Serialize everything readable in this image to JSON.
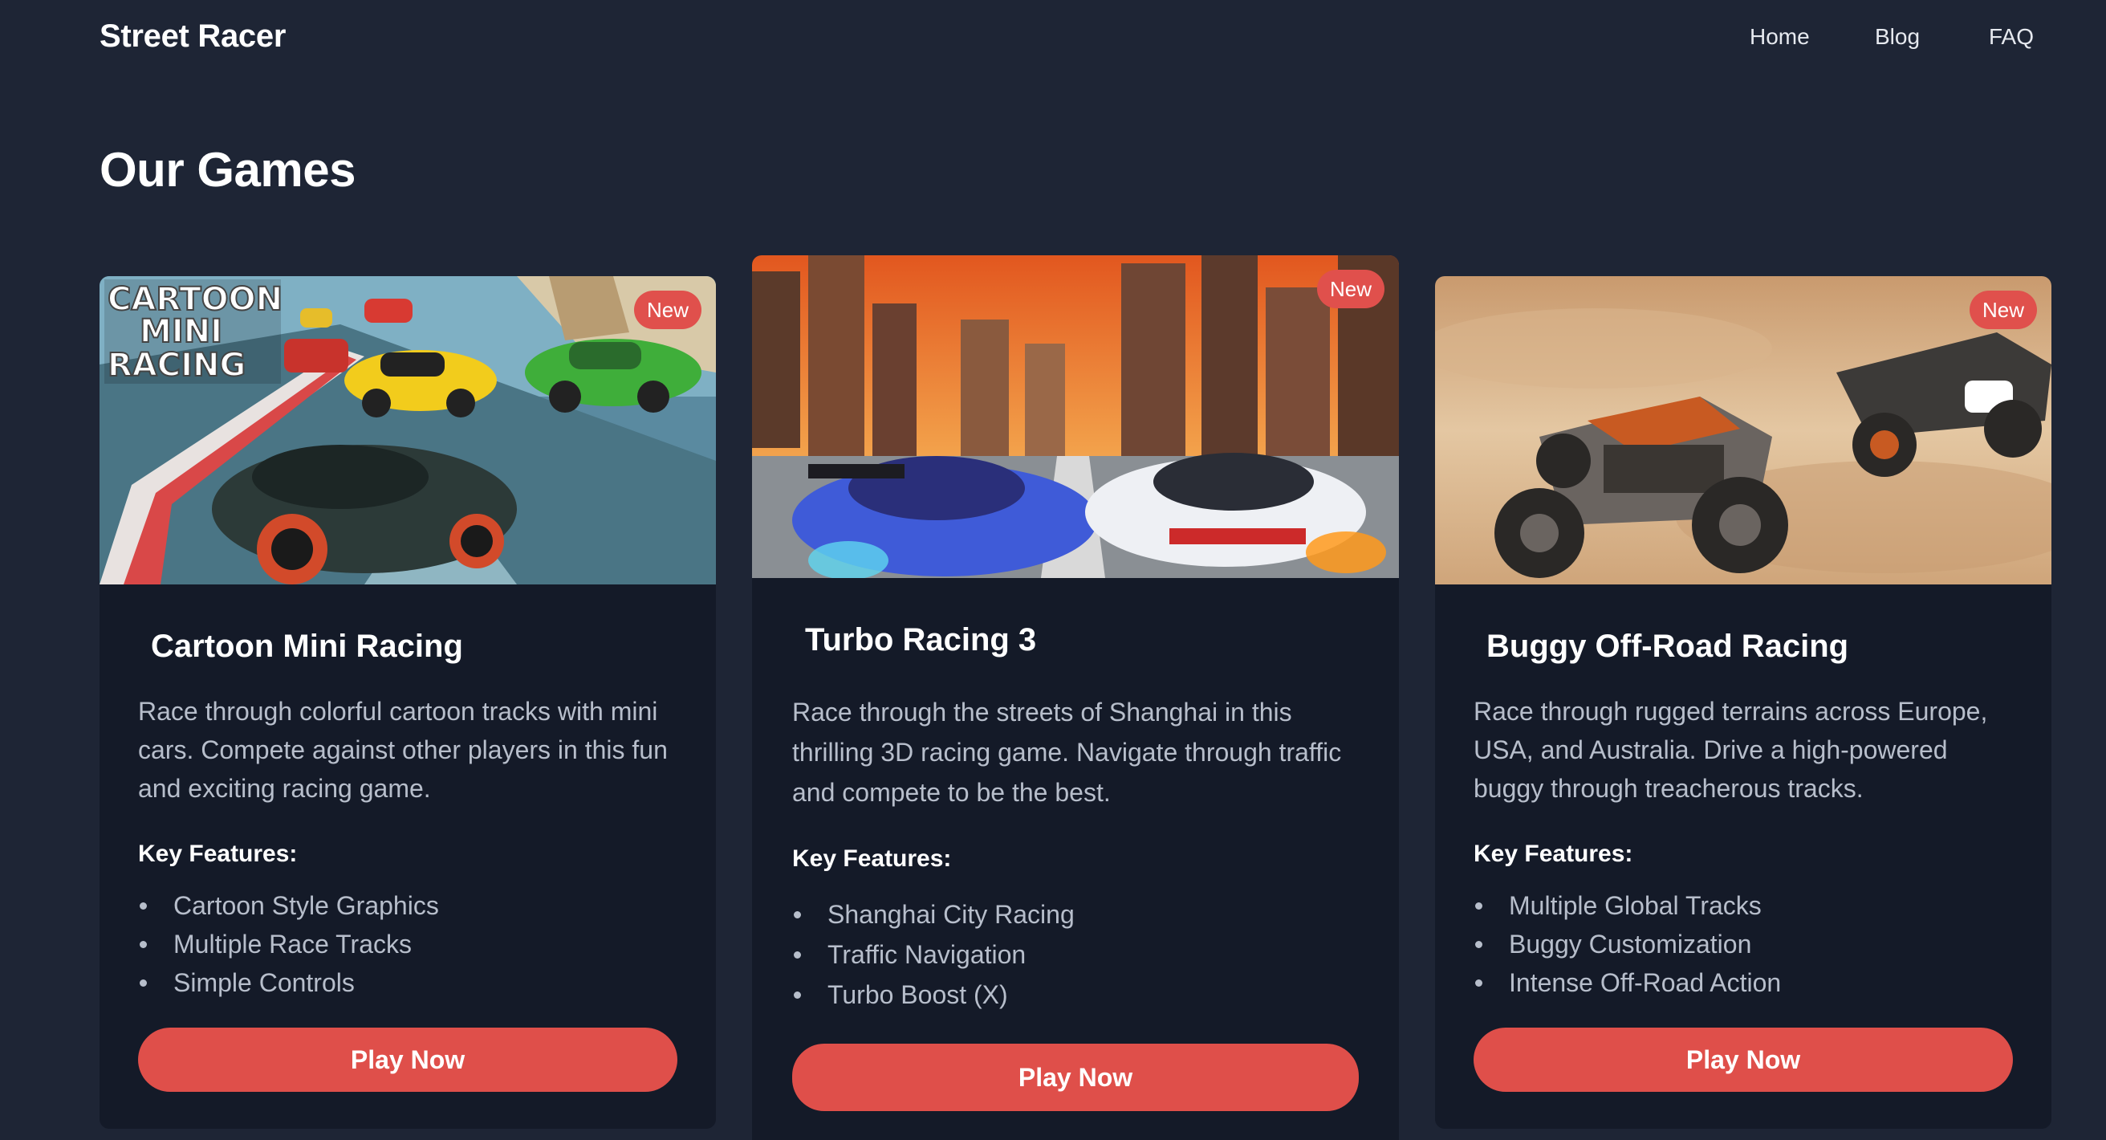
{
  "header": {
    "brand": "Street Racer",
    "nav": [
      {
        "label": "Home"
      },
      {
        "label": "Blog"
      },
      {
        "label": "FAQ"
      }
    ]
  },
  "section_title": "Our Games",
  "games": [
    {
      "badge": "New",
      "title": "Cartoon Mini Racing",
      "image_logo_text": [
        "CARTOON",
        "MINI",
        "RACING"
      ],
      "description": "Race through colorful cartoon tracks with mini cars. Compete against other players in this fun and exciting racing game.",
      "features_heading": "Key Features:",
      "features": [
        "Cartoon Style Graphics",
        "Multiple Race Tracks",
        "Simple Controls"
      ],
      "button": "Play Now"
    },
    {
      "badge": "New",
      "title": "Turbo Racing 3",
      "description": "Race through the streets of Shanghai in this thrilling 3D racing game. Navigate through traffic and compete to be the best.",
      "features_heading": "Key Features:",
      "features": [
        "Shanghai City Racing",
        "Traffic Navigation",
        "Turbo Boost (X)"
      ],
      "button": "Play Now"
    },
    {
      "badge": "New",
      "title": "Buggy Off-Road Racing",
      "description": "Race through rugged terrains across Europe, USA, and Australia. Drive a high-powered buggy through treacherous tracks.",
      "features_heading": "Key Features:",
      "features": [
        "Multiple Global Tracks",
        "Buggy Customization",
        "Intense Off-Road Action"
      ],
      "button": "Play Now"
    }
  ],
  "colors": {
    "background": "#1e2535",
    "card": "#141a28",
    "accent": "#df4f4a",
    "muted_text": "#b7becb"
  }
}
